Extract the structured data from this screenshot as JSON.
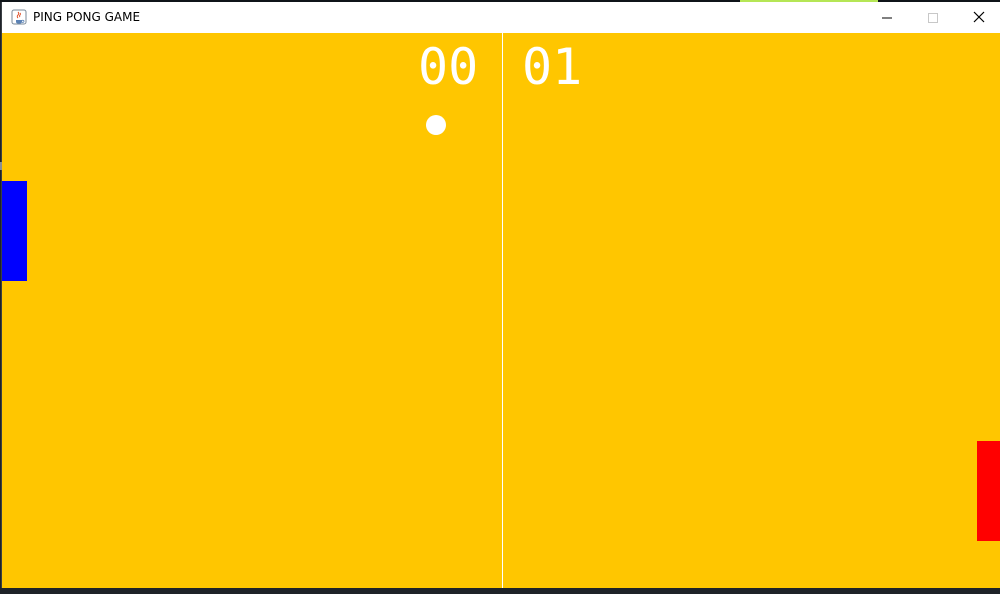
{
  "window": {
    "title": "PING PONG GAME",
    "icons": {
      "app": "java-icon",
      "minimize": "minimize-icon",
      "maximize": "maximize-icon",
      "close": "close-icon"
    }
  },
  "game": {
    "score_left": "00",
    "score_right": "01",
    "colors": {
      "background": "#ffc600",
      "center_line": "#ffffff",
      "ball": "#ffffff",
      "score": "#ffffff",
      "left_paddle": "#0000ff",
      "right_paddle": "#ff0000"
    }
  }
}
